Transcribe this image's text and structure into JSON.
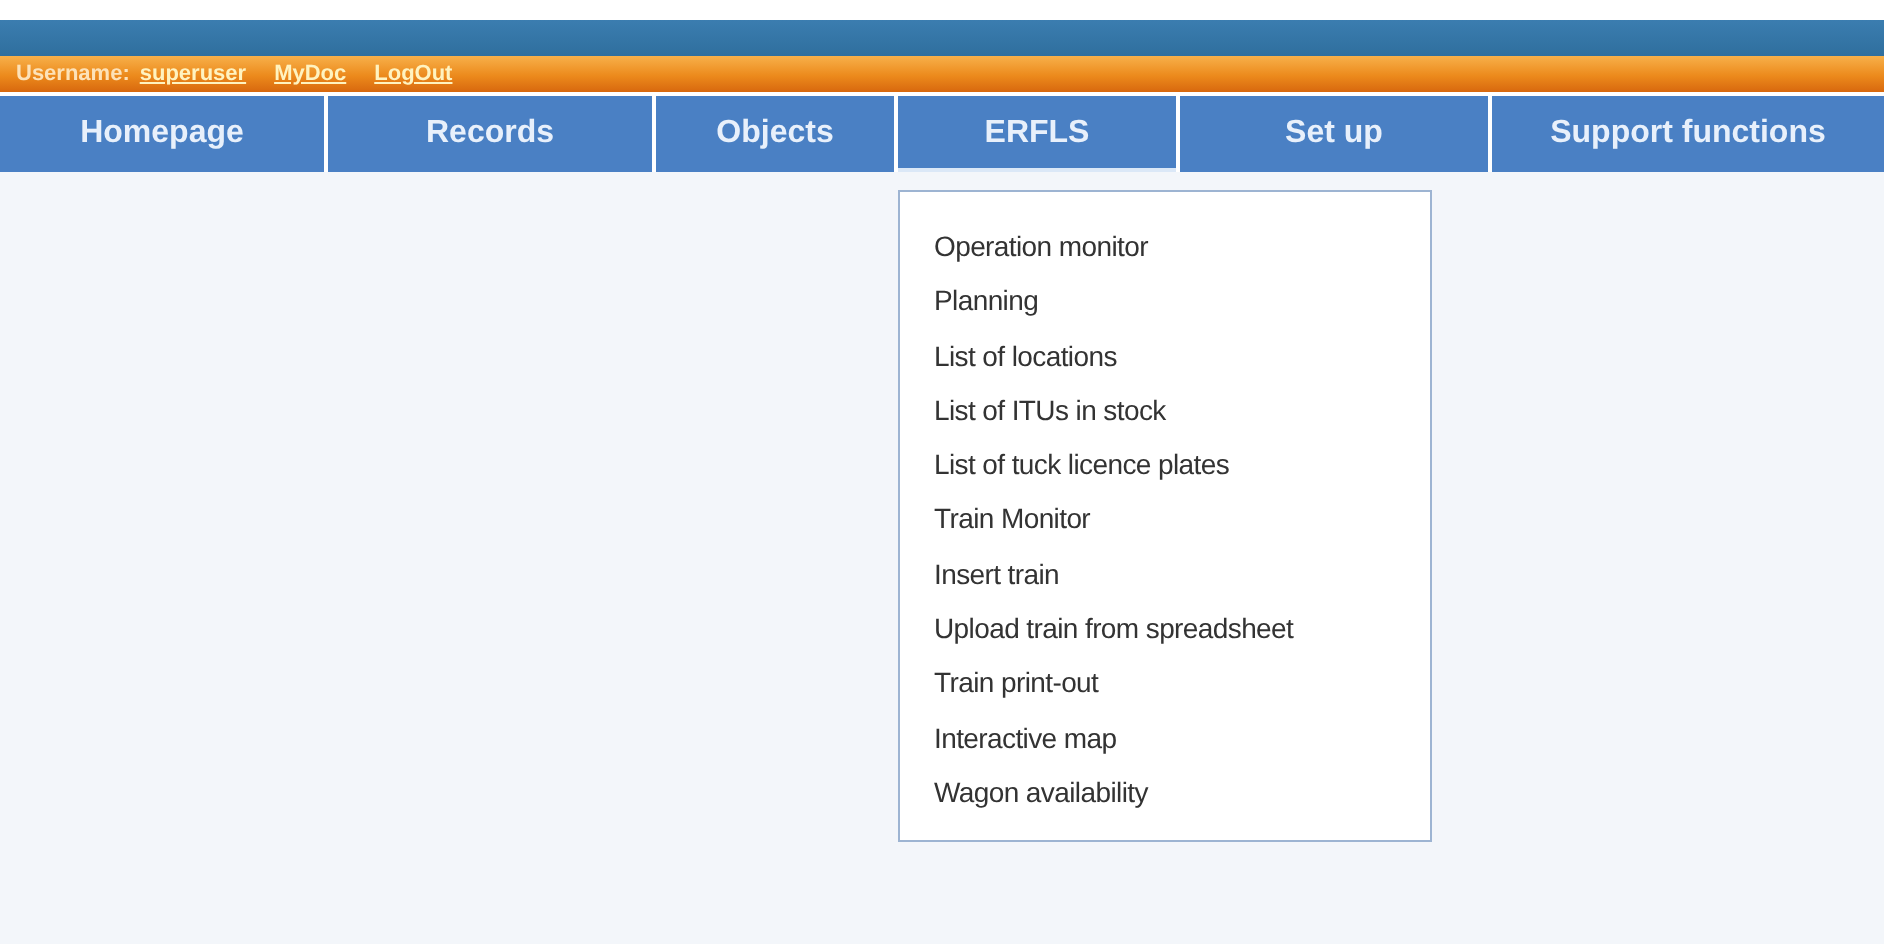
{
  "user_bar": {
    "label": "Username:",
    "username": "superuser",
    "links": [
      "MyDoc",
      "LogOut"
    ]
  },
  "nav": [
    {
      "label": "Homepage",
      "expanded": false
    },
    {
      "label": "Records",
      "expanded": false
    },
    {
      "label": "Objects",
      "expanded": false
    },
    {
      "label": "ERFLS",
      "expanded": true
    },
    {
      "label": "Set up",
      "expanded": false
    },
    {
      "label": "Support functions",
      "expanded": false
    }
  ],
  "dropdown": {
    "items": [
      "Operation monitor",
      "Planning",
      "List of locations",
      "List of ITUs in stock",
      "List of tuck licence plates",
      "Train Monitor",
      "Insert train",
      "Upload train from spreadsheet",
      "Train print-out",
      "Interactive map",
      "Wagon availability"
    ]
  }
}
